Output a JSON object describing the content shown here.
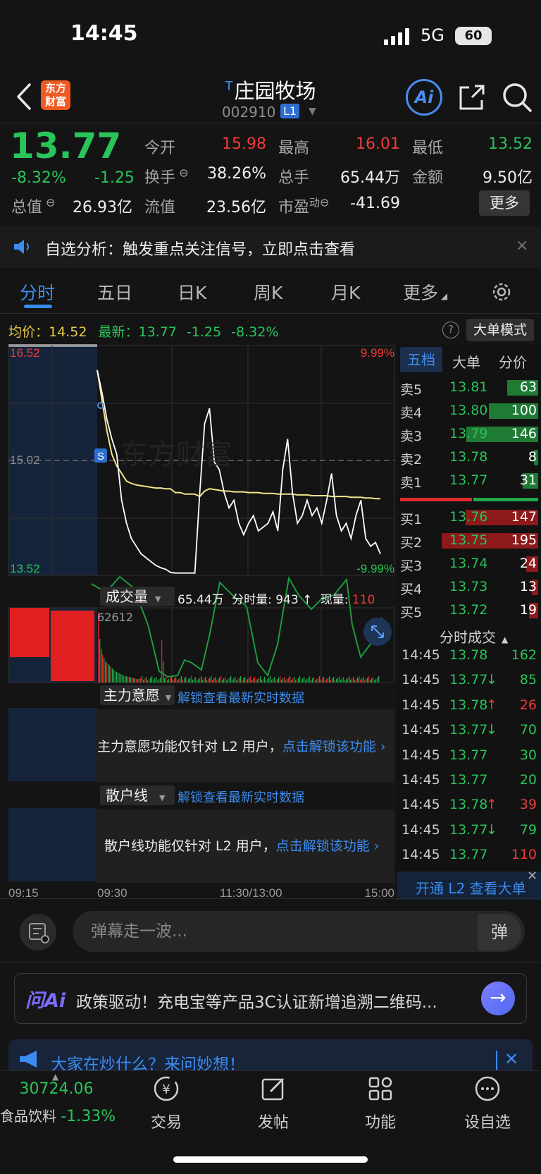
{
  "status_bar": {
    "time": "14:45",
    "network": "5G",
    "battery": "60"
  },
  "header": {
    "back": "back",
    "logo_text": "东方财富",
    "t_mark": "T",
    "stock_name": "庄园牧场",
    "stock_code": "002910",
    "level_badge": "L1",
    "ai_label": "Ai"
  },
  "quote": {
    "price": "13.77",
    "change_pct": "-8.32%",
    "change": "-1.25",
    "open_label": "今开",
    "open": "15.98",
    "high_label": "最高",
    "high": "16.01",
    "low_label": "最低",
    "low": "13.52",
    "turnover_label": "换手",
    "turnover": "38.26%",
    "volume_label": "总手",
    "volume": "65.44万",
    "amount_label": "金额",
    "amount": "9.50亿",
    "mktcap_label": "总值",
    "mktcap": "26.93亿",
    "float_label": "流值",
    "float": "23.56亿",
    "pe_label": "市盈",
    "pe_sup": "动",
    "pe": "-41.69",
    "more_button": "更多"
  },
  "notice": {
    "text": "自选分析：触发重点关注信号，立即点击查看",
    "close": "×"
  },
  "tabs": [
    "分时",
    "五日",
    "日K",
    "周K",
    "月K",
    "更多"
  ],
  "chart_info": {
    "avg_label": "均价：",
    "avg": "14.52",
    "latest_label": "最新：",
    "latest": "13.77",
    "latest_chg": "-1.25",
    "latest_pct": "-8.32%",
    "mode_button": "大单模式"
  },
  "chart_data": {
    "type": "line",
    "title": "",
    "y_top": "16.52",
    "y_mid": "15.02",
    "y_bottom": "13.52",
    "pct_top": "9.99%",
    "pct_bottom": "-9.99%",
    "ylim": [
      13.52,
      16.52
    ],
    "x_labels": [
      "09:15",
      "09:30",
      "11:30/13:00",
      "15:00"
    ],
    "series": [
      {
        "name": "",
        "color": "#ffffff",
        "values": [
          16.2,
          15.9,
          15.55,
          15.3,
          15.1,
          14.5,
          14.2,
          14.0,
          13.9,
          13.8,
          13.75,
          13.7,
          13.65,
          13.62,
          13.6,
          13.56,
          13.55,
          13.55,
          13.55,
          13.55,
          13.55,
          14.6,
          15.5,
          15.7,
          15.0,
          14.9,
          14.6,
          14.4,
          14.5,
          14.2,
          14.05,
          14.2,
          14.3,
          14.1,
          14.15,
          14.2,
          14.35,
          14.1,
          14.9,
          15.3,
          14.6,
          14.2,
          14.3,
          14.5,
          14.3,
          14.4,
          14.2,
          14.5,
          14.85,
          14.3,
          14.1,
          14.2,
          14.0,
          14.3,
          14.5,
          14.0,
          13.9,
          13.95,
          13.8
        ]
      },
      {
        "name": "",
        "color": "#f0e48a",
        "values": [
          16.2,
          15.8,
          15.4,
          15.1,
          14.95,
          14.85,
          14.75,
          14.72,
          14.7,
          14.69,
          14.68,
          14.67,
          14.66,
          14.66,
          14.65,
          14.65,
          14.6,
          14.6,
          14.58,
          14.58,
          14.58,
          14.55,
          14.62,
          14.65,
          14.64,
          14.63,
          14.62,
          14.62,
          14.61,
          14.61,
          14.61,
          14.6,
          14.6,
          14.6,
          14.59,
          14.59,
          14.59,
          14.58,
          14.58,
          14.58,
          14.58,
          14.57,
          14.57,
          14.57,
          14.56,
          14.56,
          14.56,
          14.56,
          14.55,
          14.55,
          14.55,
          14.55,
          14.54,
          14.54,
          14.54,
          14.53,
          14.53,
          14.52,
          14.52
        ]
      }
    ],
    "volume": {
      "label": "成交量",
      "total": "65.44万",
      "tick_label": "分时量:",
      "tick_value": "943",
      "tick_arrow": "↑",
      "now_label": "现量:",
      "now_value": "110",
      "max_label": "62612"
    }
  },
  "indicators": [
    {
      "name": "主力意愿",
      "unlock": "解锁查看最新实时数据",
      "note": "主力意愿功能仅针对 L2 用户，",
      "link": "点击解锁该功能"
    },
    {
      "name": "散户线",
      "unlock": "解锁查看最新实时数据",
      "note": "散户线功能仅针对 L2 用户，",
      "link": "点击解锁该功能"
    }
  ],
  "order_book": {
    "tabs": [
      "五档",
      "大单",
      "分价"
    ],
    "asks": [
      {
        "label": "卖5",
        "price": "13.81",
        "qty": "63"
      },
      {
        "label": "卖4",
        "price": "13.80",
        "qty": "100"
      },
      {
        "label": "卖3",
        "price": "13.79",
        "qty": "146"
      },
      {
        "label": "卖2",
        "price": "13.78",
        "qty": "8"
      },
      {
        "label": "卖1",
        "price": "13.77",
        "qty": "31"
      }
    ],
    "bids": [
      {
        "label": "买1",
        "price": "13.76",
        "qty": "147"
      },
      {
        "label": "买2",
        "price": "13.75",
        "qty": "195"
      },
      {
        "label": "买3",
        "price": "13.74",
        "qty": "24"
      },
      {
        "label": "买4",
        "price": "13.73",
        "qty": "13"
      },
      {
        "label": "买5",
        "price": "13.72",
        "qty": "19"
      }
    ]
  },
  "ticks": {
    "title": "分时成交",
    "rows": [
      {
        "time": "14:45",
        "price": "13.78",
        "dir": "",
        "qty": "162",
        "color": "green"
      },
      {
        "time": "14:45",
        "price": "13.77",
        "dir": "↓",
        "qty": "85",
        "color": "green"
      },
      {
        "time": "14:45",
        "price": "13.78",
        "dir": "↑",
        "qty": "26",
        "color": "red"
      },
      {
        "time": "14:45",
        "price": "13.77",
        "dir": "↓",
        "qty": "70",
        "color": "green"
      },
      {
        "time": "14:45",
        "price": "13.77",
        "dir": "",
        "qty": "30",
        "color": "green"
      },
      {
        "time": "14:45",
        "price": "13.77",
        "dir": "",
        "qty": "20",
        "color": "green"
      },
      {
        "time": "14:45",
        "price": "13.78",
        "dir": "↑",
        "qty": "39",
        "color": "red"
      },
      {
        "time": "14:45",
        "price": "13.77",
        "dir": "↓",
        "qty": "79",
        "color": "green"
      },
      {
        "time": "14:45",
        "price": "13.77",
        "dir": "",
        "qty": "110",
        "color": "red"
      }
    ],
    "l2_banner": "开通 L2 查看大单"
  },
  "danmu": {
    "placeholder": "弹幕走一波...",
    "button": "弹"
  },
  "ai_bar": {
    "logo": "问Ai",
    "text": "政策驱动！充电宝等产品3C认证新增追溯二维码..."
  },
  "hot_bar": {
    "text": "大家在炒什么？来问妙想！"
  },
  "nav": {
    "index_value": "30724.06",
    "index_name": "食品饮料",
    "index_pct": "-1.33%",
    "items": [
      "交易",
      "发帖",
      "功能",
      "设自选"
    ]
  }
}
